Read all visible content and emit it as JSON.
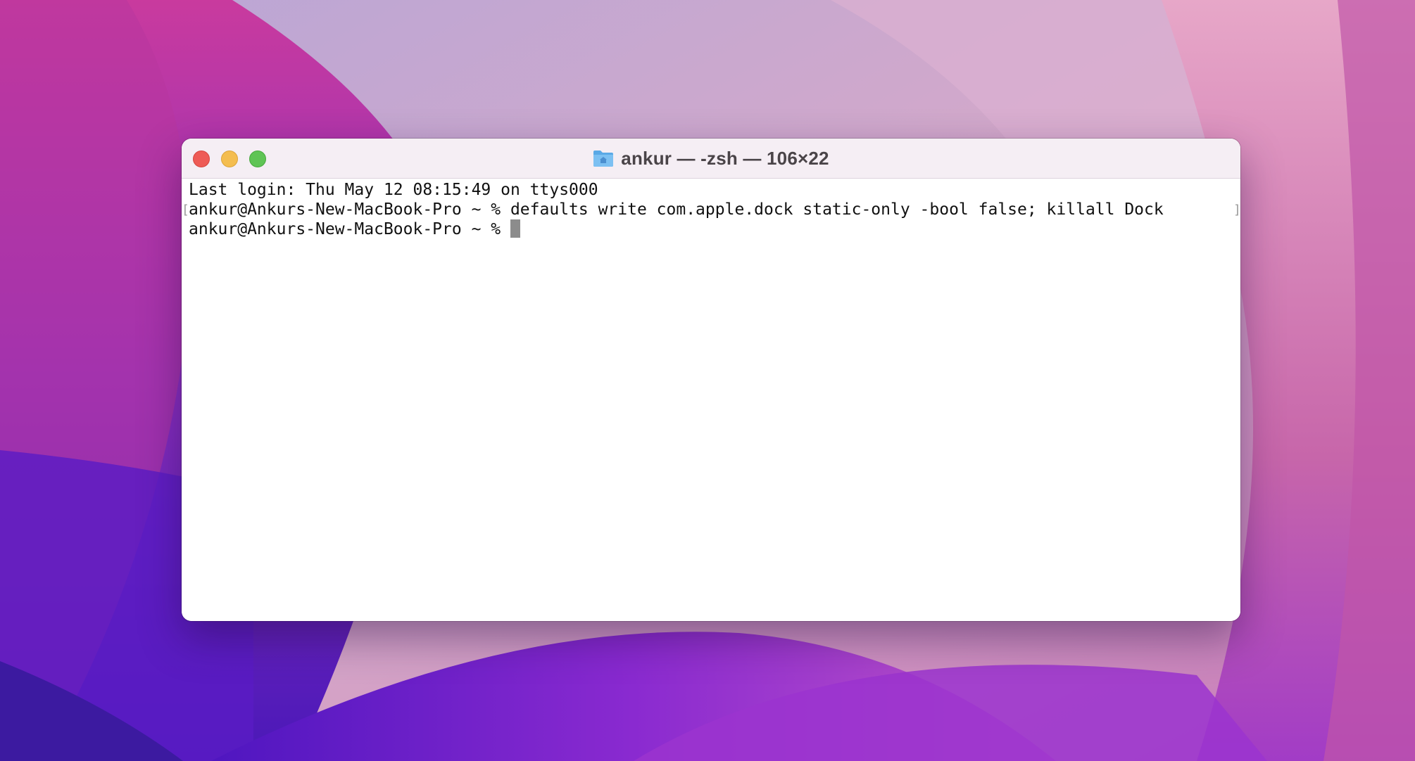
{
  "window": {
    "title": "ankur — -zsh — 106×22",
    "title_icon": "folder-icon"
  },
  "traffic_lights": {
    "close_color": "#ee5b56",
    "minimize_color": "#f4bd4f",
    "zoom_color": "#5fc455"
  },
  "terminal": {
    "last_login": "Last login: Thu May 12 08:15:49 on ttys000",
    "command_line": "ankur@Ankurs-New-MacBook-Pro ~ % defaults write com.apple.dock static-only -bool false; killall Dock",
    "prompt": "ankur@Ankurs-New-MacBook-Pro ~ % ",
    "mark_left": "[",
    "mark_right": "]"
  }
}
